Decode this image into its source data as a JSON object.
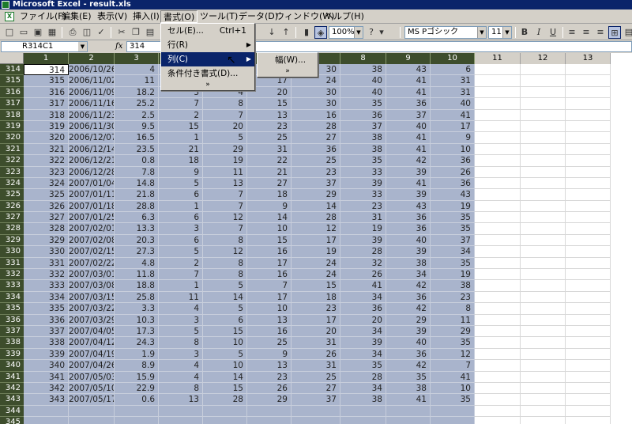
{
  "window": {
    "title": "Microsoft Excel - result.xls"
  },
  "menubar": {
    "items": [
      "ファイル(F)",
      "編集(E)",
      "表示(V)",
      "挿入(I)",
      "書式(O)",
      "ツール(T)",
      "データ(D)",
      "ウィンドウ(W)",
      "ヘルプ(H)"
    ],
    "active_index": 4
  },
  "toolbar": {
    "zoom": "100%",
    "font": "MS Pゴシック",
    "size": "11",
    "bold": "B",
    "italic": "I",
    "underline": "U"
  },
  "formula_bar": {
    "name_box": "R314C1",
    "fx": "fx",
    "value": "314"
  },
  "format_menu": {
    "items": [
      {
        "label": "セル(E)...",
        "shortcut": "Ctrl+1",
        "submenu": false
      },
      {
        "label": "行(R)",
        "shortcut": "",
        "submenu": true
      },
      {
        "label": "列(C)",
        "shortcut": "",
        "submenu": true,
        "highlighted": true
      },
      {
        "label": "条件付き書式(D)...",
        "shortcut": "",
        "submenu": false
      }
    ],
    "expand": "»"
  },
  "column_submenu": {
    "items": [
      {
        "label": "幅(W)..."
      }
    ],
    "expand": "»"
  },
  "columns": [
    "1",
    "2",
    "3",
    "4",
    "5",
    "6",
    "7",
    "8",
    "9",
    "10",
    "11",
    "12",
    "13"
  ],
  "rows": [
    {
      "n": "314",
      "cells": [
        "314",
        "2006/10/26",
        "4",
        "",
        "",
        "",
        "30",
        "38",
        "43",
        "6"
      ]
    },
    {
      "n": "315",
      "cells": [
        "315",
        "2006/11/02",
        "11",
        "",
        "2",
        "17",
        "24",
        "40",
        "41",
        "31"
      ]
    },
    {
      "n": "316",
      "cells": [
        "316",
        "2006/11/09",
        "18.2",
        "3",
        "4",
        "20",
        "30",
        "40",
        "41",
        "31"
      ]
    },
    {
      "n": "317",
      "cells": [
        "317",
        "2006/11/16",
        "25.2",
        "7",
        "8",
        "15",
        "30",
        "35",
        "36",
        "40"
      ]
    },
    {
      "n": "318",
      "cells": [
        "318",
        "2006/11/23",
        "2.5",
        "2",
        "7",
        "13",
        "16",
        "36",
        "37",
        "41"
      ]
    },
    {
      "n": "319",
      "cells": [
        "319",
        "2006/11/30",
        "9.5",
        "15",
        "20",
        "23",
        "28",
        "37",
        "40",
        "17"
      ]
    },
    {
      "n": "320",
      "cells": [
        "320",
        "2006/12/07",
        "16.5",
        "1",
        "5",
        "25",
        "27",
        "38",
        "41",
        "9"
      ]
    },
    {
      "n": "321",
      "cells": [
        "321",
        "2006/12/14",
        "23.5",
        "21",
        "29",
        "31",
        "36",
        "38",
        "41",
        "10"
      ]
    },
    {
      "n": "322",
      "cells": [
        "322",
        "2006/12/21",
        "0.8",
        "18",
        "19",
        "22",
        "25",
        "35",
        "42",
        "36"
      ]
    },
    {
      "n": "323",
      "cells": [
        "323",
        "2006/12/28",
        "7.8",
        "9",
        "11",
        "21",
        "23",
        "33",
        "39",
        "26"
      ]
    },
    {
      "n": "324",
      "cells": [
        "324",
        "2007/01/04",
        "14.8",
        "5",
        "13",
        "27",
        "37",
        "39",
        "41",
        "36"
      ]
    },
    {
      "n": "325",
      "cells": [
        "325",
        "2007/01/11",
        "21.8",
        "6",
        "7",
        "18",
        "29",
        "33",
        "39",
        "43"
      ]
    },
    {
      "n": "326",
      "cells": [
        "326",
        "2007/01/18",
        "28.8",
        "1",
        "7",
        "9",
        "14",
        "23",
        "43",
        "19"
      ]
    },
    {
      "n": "327",
      "cells": [
        "327",
        "2007/01/25",
        "6.3",
        "6",
        "12",
        "14",
        "28",
        "31",
        "36",
        "35"
      ]
    },
    {
      "n": "328",
      "cells": [
        "328",
        "2007/02/01",
        "13.3",
        "3",
        "7",
        "10",
        "12",
        "19",
        "36",
        "35"
      ]
    },
    {
      "n": "329",
      "cells": [
        "329",
        "2007/02/08",
        "20.3",
        "6",
        "8",
        "15",
        "17",
        "39",
        "40",
        "37"
      ]
    },
    {
      "n": "330",
      "cells": [
        "330",
        "2007/02/15",
        "27.3",
        "5",
        "12",
        "16",
        "19",
        "28",
        "39",
        "34"
      ]
    },
    {
      "n": "331",
      "cells": [
        "331",
        "2007/02/22",
        "4.8",
        "2",
        "8",
        "17",
        "24",
        "32",
        "38",
        "35"
      ]
    },
    {
      "n": "332",
      "cells": [
        "332",
        "2007/03/01",
        "11.8",
        "7",
        "8",
        "16",
        "24",
        "26",
        "34",
        "19"
      ]
    },
    {
      "n": "333",
      "cells": [
        "333",
        "2007/03/08",
        "18.8",
        "1",
        "5",
        "7",
        "15",
        "41",
        "42",
        "38"
      ]
    },
    {
      "n": "334",
      "cells": [
        "334",
        "2007/03/15",
        "25.8",
        "11",
        "14",
        "17",
        "18",
        "34",
        "36",
        "23"
      ]
    },
    {
      "n": "335",
      "cells": [
        "335",
        "2007/03/22",
        "3.3",
        "4",
        "5",
        "10",
        "23",
        "36",
        "42",
        "8"
      ]
    },
    {
      "n": "336",
      "cells": [
        "336",
        "2007/03/29",
        "10.3",
        "3",
        "6",
        "13",
        "17",
        "20",
        "29",
        "11"
      ]
    },
    {
      "n": "337",
      "cells": [
        "337",
        "2007/04/05",
        "17.3",
        "5",
        "15",
        "16",
        "20",
        "34",
        "39",
        "29"
      ]
    },
    {
      "n": "338",
      "cells": [
        "338",
        "2007/04/12",
        "24.3",
        "8",
        "10",
        "25",
        "31",
        "39",
        "40",
        "35"
      ]
    },
    {
      "n": "339",
      "cells": [
        "339",
        "2007/04/19",
        "1.9",
        "3",
        "5",
        "9",
        "26",
        "34",
        "36",
        "12"
      ]
    },
    {
      "n": "340",
      "cells": [
        "340",
        "2007/04/26",
        "8.9",
        "4",
        "10",
        "13",
        "31",
        "35",
        "42",
        "7"
      ]
    },
    {
      "n": "341",
      "cells": [
        "341",
        "2007/05/03",
        "15.9",
        "4",
        "14",
        "23",
        "25",
        "28",
        "35",
        "41"
      ]
    },
    {
      "n": "342",
      "cells": [
        "342",
        "2007/05/10",
        "22.9",
        "8",
        "15",
        "26",
        "27",
        "34",
        "38",
        "10"
      ]
    },
    {
      "n": "343",
      "cells": [
        "343",
        "2007/05/17",
        "0.6",
        "13",
        "28",
        "29",
        "37",
        "38",
        "41",
        "35"
      ]
    },
    {
      "n": "344",
      "cells": [
        "",
        "",
        "",
        "",
        "",
        "",
        "",
        "",
        "",
        ""
      ]
    },
    {
      "n": "345",
      "cells": [
        "",
        "",
        "",
        "",
        "",
        "",
        "",
        "",
        "",
        ""
      ]
    }
  ]
}
